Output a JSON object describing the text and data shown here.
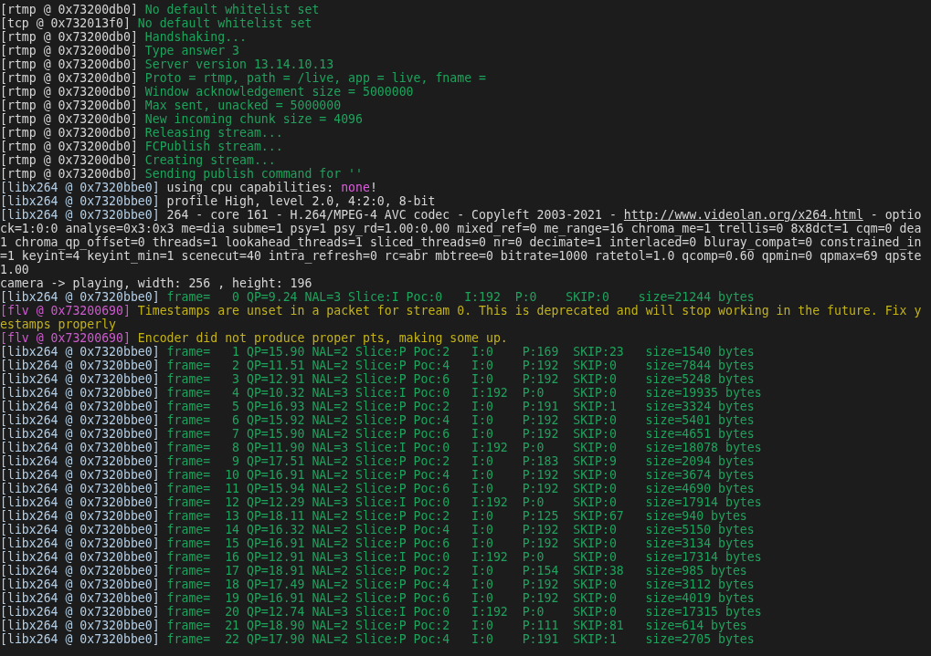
{
  "terminal": {
    "lines": [
      {
        "segments": [
          {
            "kind": "source",
            "text": "[rtmp @ 0x73200db0]"
          },
          {
            "kind": "verbose",
            "text": "No default whitelist set"
          }
        ]
      },
      {
        "segments": [
          {
            "kind": "source",
            "text": "[tcp @ 0x732013f0]"
          },
          {
            "kind": "verbose",
            "text": "No default whitelist set"
          }
        ]
      },
      {
        "segments": [
          {
            "kind": "source",
            "text": "[rtmp @ 0x73200db0]"
          },
          {
            "kind": "verbose",
            "text": "Handshaking..."
          }
        ]
      },
      {
        "segments": [
          {
            "kind": "source",
            "text": "[rtmp @ 0x73200db0]"
          },
          {
            "kind": "verbose",
            "text": "Type answer 3"
          }
        ]
      },
      {
        "segments": [
          {
            "kind": "source",
            "text": "[rtmp @ 0x73200db0]"
          },
          {
            "kind": "verbose",
            "text": "Server version 13.14.10.13"
          }
        ]
      },
      {
        "segments": [
          {
            "kind": "source",
            "text": "[rtmp @ 0x73200db0]"
          },
          {
            "kind": "verbose",
            "text": "Proto = rtmp, path = /live, app = live, fname ="
          }
        ]
      },
      {
        "segments": [
          {
            "kind": "source",
            "text": "[rtmp @ 0x73200db0]"
          },
          {
            "kind": "verbose",
            "text": "Window acknowledgement size = 5000000"
          }
        ]
      },
      {
        "segments": [
          {
            "kind": "source",
            "text": "[rtmp @ 0x73200db0]"
          },
          {
            "kind": "verbose",
            "text": "Max sent, unacked = 5000000"
          }
        ]
      },
      {
        "segments": [
          {
            "kind": "source",
            "text": "[rtmp @ 0x73200db0]"
          },
          {
            "kind": "verbose",
            "text": "New incoming chunk size = 4096"
          }
        ]
      },
      {
        "segments": [
          {
            "kind": "source",
            "text": "[rtmp @ 0x73200db0]"
          },
          {
            "kind": "verbose",
            "text": "Releasing stream..."
          }
        ]
      },
      {
        "segments": [
          {
            "kind": "source",
            "text": "[rtmp @ 0x73200db0]"
          },
          {
            "kind": "verbose",
            "text": "FCPublish stream..."
          }
        ]
      },
      {
        "segments": [
          {
            "kind": "source",
            "text": "[rtmp @ 0x73200db0]"
          },
          {
            "kind": "verbose",
            "text": "Creating stream..."
          }
        ]
      },
      {
        "segments": [
          {
            "kind": "source",
            "text": "[rtmp @ 0x73200db0]"
          },
          {
            "kind": "verbose",
            "text": "Sending publish command for ''"
          }
        ]
      },
      {
        "segments": [
          {
            "kind": "codec_source",
            "text": "[libx264 @ 0x7320bbe0]"
          },
          {
            "kind": "info",
            "text": "using cpu capabilities:"
          },
          {
            "kind": "accent",
            "text": "none"
          },
          {
            "kind": "info",
            "text": "!"
          }
        ]
      },
      {
        "segments": [
          {
            "kind": "codec_source",
            "text": "[libx264 @ 0x7320bbe0]"
          },
          {
            "kind": "info",
            "text": "profile High, level 2.0, 4:2:0, 8-bit"
          }
        ]
      },
      {
        "segments": [
          {
            "kind": "codec_source",
            "text": "[libx264 @ 0x7320bbe0]"
          },
          {
            "kind": "info",
            "text": "264 - core 161 - H.264/MPEG-4 AVC codec - Copyleft 2003-2021 -"
          },
          {
            "kind": "link",
            "text": "http://www.videolan.org/x264.html"
          },
          {
            "kind": "info",
            "text": "- optio"
          }
        ]
      },
      {
        "segments": [
          {
            "kind": "info",
            "text": "ck=1:0:0 analyse=0x3:0x3 me=dia subme=1 psy=1 psy_rd=1.00:0.00 mixed_ref=0 me_range=16 chroma_me=1 trellis=0 8x8dct=1 cqm=0 dea"
          }
        ]
      },
      {
        "segments": [
          {
            "kind": "info",
            "text": "1 chroma_qp_offset=0 threads=1 lookahead_threads=1 sliced_threads=0 nr=0 decimate=1 interlaced=0 bluray_compat=0 constrained_in"
          }
        ]
      },
      {
        "segments": [
          {
            "kind": "info",
            "text": "=1 keyint=4 keyint_min=1 scenecut=40 intra_refresh=0 rc=abr mbtree=0 bitrate=1000 ratetol=1.0 qcomp=0.60 qpmin=0 qpmax=69 qpste"
          }
        ]
      },
      {
        "segments": [
          {
            "kind": "info",
            "text": "1.00"
          }
        ]
      },
      {
        "segments": [
          {
            "kind": "info",
            "text": "camera -> playing, width: 256 , height: 196"
          }
        ]
      },
      {
        "segments": [
          {
            "kind": "codec_source",
            "text": "[libx264 @ 0x7320bbe0]"
          },
          {
            "kind": "verbose",
            "text": "frame=   0 QP=9.24 NAL=3 Slice:I Poc:0   I:192  P:0    SKIP:0    size=21244 bytes"
          }
        ]
      },
      {
        "segments": [
          {
            "kind": "muxer_source",
            "text": "[flv @ 0x73200690]"
          },
          {
            "kind": "warning",
            "text": "Timestamps are unset in a packet for stream 0. This is deprecated and will stop working in the future. Fix y"
          }
        ]
      },
      {
        "segments": [
          {
            "kind": "warning",
            "text": "estamps properly"
          }
        ]
      },
      {
        "segments": [
          {
            "kind": "muxer_source",
            "text": "[flv @ 0x73200690]"
          },
          {
            "kind": "warning",
            "text": "Encoder did not produce proper pts, making some up."
          }
        ]
      },
      {
        "segments": [
          {
            "kind": "codec_source",
            "text": "[libx264 @ 0x7320bbe0]"
          },
          {
            "kind": "verbose",
            "text": "frame=   1 QP=15.90 NAL=2 Slice:P Poc:2   I:0    P:169  SKIP:23   size=1540 bytes"
          }
        ]
      },
      {
        "segments": [
          {
            "kind": "codec_source",
            "text": "[libx264 @ 0x7320bbe0]"
          },
          {
            "kind": "verbose",
            "text": "frame=   2 QP=11.51 NAL=2 Slice:P Poc:4   I:0    P:192  SKIP:0    size=7844 bytes"
          }
        ]
      },
      {
        "segments": [
          {
            "kind": "codec_source",
            "text": "[libx264 @ 0x7320bbe0]"
          },
          {
            "kind": "verbose",
            "text": "frame=   3 QP=12.91 NAL=2 Slice:P Poc:6   I:0    P:192  SKIP:0    size=5248 bytes"
          }
        ]
      },
      {
        "segments": [
          {
            "kind": "codec_source",
            "text": "[libx264 @ 0x7320bbe0]"
          },
          {
            "kind": "verbose",
            "text": "frame=   4 QP=10.32 NAL=3 Slice:I Poc:0   I:192  P:0    SKIP:0    size=19935 bytes"
          }
        ]
      },
      {
        "segments": [
          {
            "kind": "codec_source",
            "text": "[libx264 @ 0x7320bbe0]"
          },
          {
            "kind": "verbose",
            "text": "frame=   5 QP=16.93 NAL=2 Slice:P Poc:2   I:0    P:191  SKIP:1    size=3324 bytes"
          }
        ]
      },
      {
        "segments": [
          {
            "kind": "codec_source",
            "text": "[libx264 @ 0x7320bbe0]"
          },
          {
            "kind": "verbose",
            "text": "frame=   6 QP=15.92 NAL=2 Slice:P Poc:4   I:0    P:192  SKIP:0    size=5401 bytes"
          }
        ]
      },
      {
        "segments": [
          {
            "kind": "codec_source",
            "text": "[libx264 @ 0x7320bbe0]"
          },
          {
            "kind": "verbose",
            "text": "frame=   7 QP=15.90 NAL=2 Slice:P Poc:6   I:0    P:192  SKIP:0    size=4651 bytes"
          }
        ]
      },
      {
        "segments": [
          {
            "kind": "codec_source",
            "text": "[libx264 @ 0x7320bbe0]"
          },
          {
            "kind": "verbose",
            "text": "frame=   8 QP=11.90 NAL=3 Slice:I Poc:0   I:192  P:0    SKIP:0    size=18078 bytes"
          }
        ]
      },
      {
        "segments": [
          {
            "kind": "codec_source",
            "text": "[libx264 @ 0x7320bbe0]"
          },
          {
            "kind": "verbose",
            "text": "frame=   9 QP=17.51 NAL=2 Slice:P Poc:2   I:0    P:183  SKIP:9    size=2094 bytes"
          }
        ]
      },
      {
        "segments": [
          {
            "kind": "codec_source",
            "text": "[libx264 @ 0x7320bbe0]"
          },
          {
            "kind": "verbose",
            "text": "frame=  10 QP=16.91 NAL=2 Slice:P Poc:4   I:0    P:192  SKIP:0    size=3674 bytes"
          }
        ]
      },
      {
        "segments": [
          {
            "kind": "codec_source",
            "text": "[libx264 @ 0x7320bbe0]"
          },
          {
            "kind": "verbose",
            "text": "frame=  11 QP=15.94 NAL=2 Slice:P Poc:6   I:0    P:192  SKIP:0    size=4690 bytes"
          }
        ]
      },
      {
        "segments": [
          {
            "kind": "codec_source",
            "text": "[libx264 @ 0x7320bbe0]"
          },
          {
            "kind": "verbose",
            "text": "frame=  12 QP=12.29 NAL=3 Slice:I Poc:0   I:192  P:0    SKIP:0    size=17914 bytes"
          }
        ]
      },
      {
        "segments": [
          {
            "kind": "codec_source",
            "text": "[libx264 @ 0x7320bbe0]"
          },
          {
            "kind": "verbose",
            "text": "frame=  13 QP=18.11 NAL=2 Slice:P Poc:2   I:0    P:125  SKIP:67   size=940 bytes"
          }
        ]
      },
      {
        "segments": [
          {
            "kind": "codec_source",
            "text": "[libx264 @ 0x7320bbe0]"
          },
          {
            "kind": "verbose",
            "text": "frame=  14 QP=16.32 NAL=2 Slice:P Poc:4   I:0    P:192  SKIP:0    size=5150 bytes"
          }
        ]
      },
      {
        "segments": [
          {
            "kind": "codec_source",
            "text": "[libx264 @ 0x7320bbe0]"
          },
          {
            "kind": "verbose",
            "text": "frame=  15 QP=16.91 NAL=2 Slice:P Poc:6   I:0    P:192  SKIP:0    size=3134 bytes"
          }
        ]
      },
      {
        "segments": [
          {
            "kind": "codec_source",
            "text": "[libx264 @ 0x7320bbe0]"
          },
          {
            "kind": "verbose",
            "text": "frame=  16 QP=12.91 NAL=3 Slice:I Poc:0   I:192  P:0    SKIP:0    size=17314 bytes"
          }
        ]
      },
      {
        "segments": [
          {
            "kind": "codec_source",
            "text": "[libx264 @ 0x7320bbe0]"
          },
          {
            "kind": "verbose",
            "text": "frame=  17 QP=18.91 NAL=2 Slice:P Poc:2   I:0    P:154  SKIP:38   size=985 bytes"
          }
        ]
      },
      {
        "segments": [
          {
            "kind": "codec_source",
            "text": "[libx264 @ 0x7320bbe0]"
          },
          {
            "kind": "verbose",
            "text": "frame=  18 QP=17.49 NAL=2 Slice:P Poc:4   I:0    P:192  SKIP:0    size=3112 bytes"
          }
        ]
      },
      {
        "segments": [
          {
            "kind": "codec_source",
            "text": "[libx264 @ 0x7320bbe0]"
          },
          {
            "kind": "verbose",
            "text": "frame=  19 QP=16.91 NAL=2 Slice:P Poc:6   I:0    P:192  SKIP:0    size=4019 bytes"
          }
        ]
      },
      {
        "segments": [
          {
            "kind": "codec_source",
            "text": "[libx264 @ 0x7320bbe0]"
          },
          {
            "kind": "verbose",
            "text": "frame=  20 QP=12.74 NAL=3 Slice:I Poc:0   I:192  P:0    SKIP:0    size=17315 bytes"
          }
        ]
      },
      {
        "segments": [
          {
            "kind": "codec_source",
            "text": "[libx264 @ 0x7320bbe0]"
          },
          {
            "kind": "verbose",
            "text": "frame=  21 QP=18.90 NAL=2 Slice:P Poc:2   I:0    P:111  SKIP:81   size=614 bytes"
          }
        ]
      },
      {
        "segments": [
          {
            "kind": "codec_source",
            "text": "[libx264 @ 0x7320bbe0]"
          },
          {
            "kind": "verbose",
            "text": "frame=  22 QP=17.90 NAL=2 Slice:P Poc:4   I:0    P:191  SKIP:1    size=2705 bytes"
          }
        ]
      }
    ]
  }
}
